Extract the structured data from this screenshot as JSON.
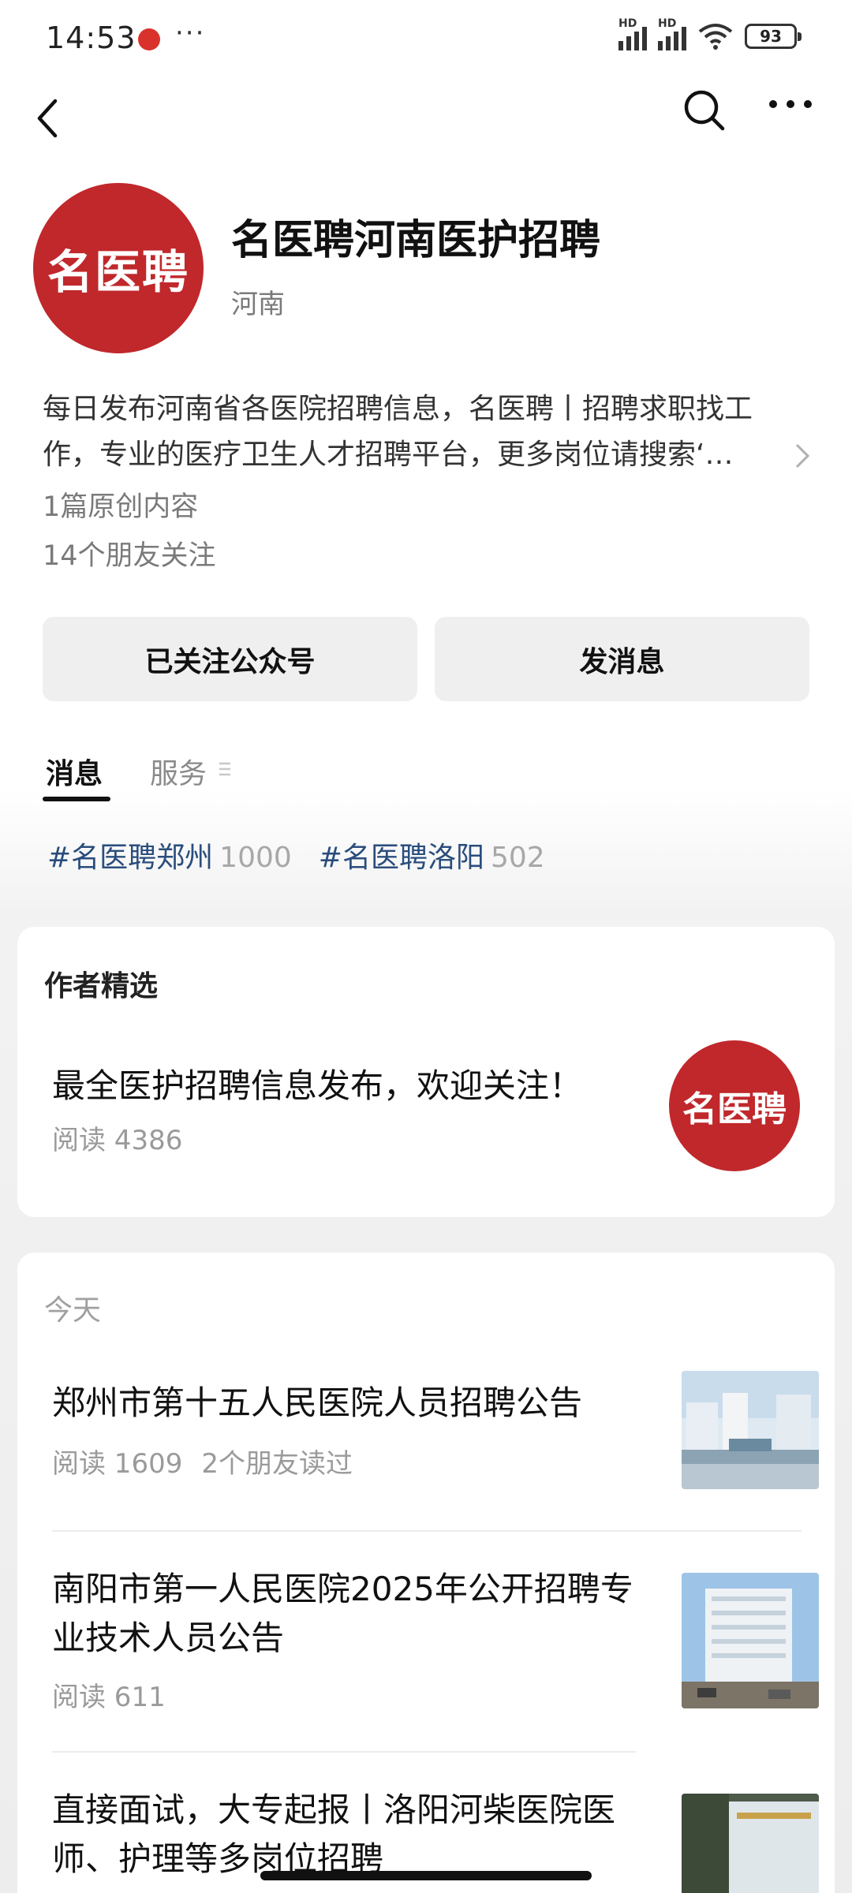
{
  "status_bar": {
    "time": "14:53",
    "dots": "···",
    "battery": "93",
    "signal1_label": "HD",
    "signal2_label": "HD"
  },
  "account": {
    "avatar_text": "名医聘",
    "name": "名医聘河南医护招聘",
    "region": "河南",
    "description": "每日发布河南省各医院招聘信息，名医聘丨招聘求职找工作，专业的医疗卫生人才招聘平台，更多岗位请搜索‘…",
    "original_count": "1篇原创内容",
    "friends_follow": "14个朋友关注"
  },
  "buttons": {
    "follow": "已关注公众号",
    "message": "发消息"
  },
  "tabs": {
    "messages": "消息",
    "services": "服务"
  },
  "hashtags": [
    {
      "name": "#名医聘郑州",
      "count": "1000"
    },
    {
      "name": "#名医聘洛阳",
      "count": "502"
    }
  ],
  "featured": {
    "section_title": "作者精选",
    "title": "最全医护招聘信息发布，欢迎关注！",
    "reads": "阅读 4386",
    "thumb_text": "名医聘"
  },
  "articles_section": {
    "day": "今天",
    "articles": [
      {
        "title": "郑州市第十五人民医院人员招聘公告",
        "reads": "阅读 1609",
        "friends": "2个朋友读过"
      },
      {
        "title": "南阳市第一人民医院2025年公开招聘专业技术人员公告",
        "reads": "阅读 611",
        "friends": ""
      },
      {
        "title": "直接面试，大专起报丨洛阳河柴医院医师、护理等多岗位招聘",
        "reads": "",
        "friends": ""
      }
    ]
  },
  "colors": {
    "brand_red": "#c0282b",
    "hashtag_blue": "#2a4d7d"
  }
}
